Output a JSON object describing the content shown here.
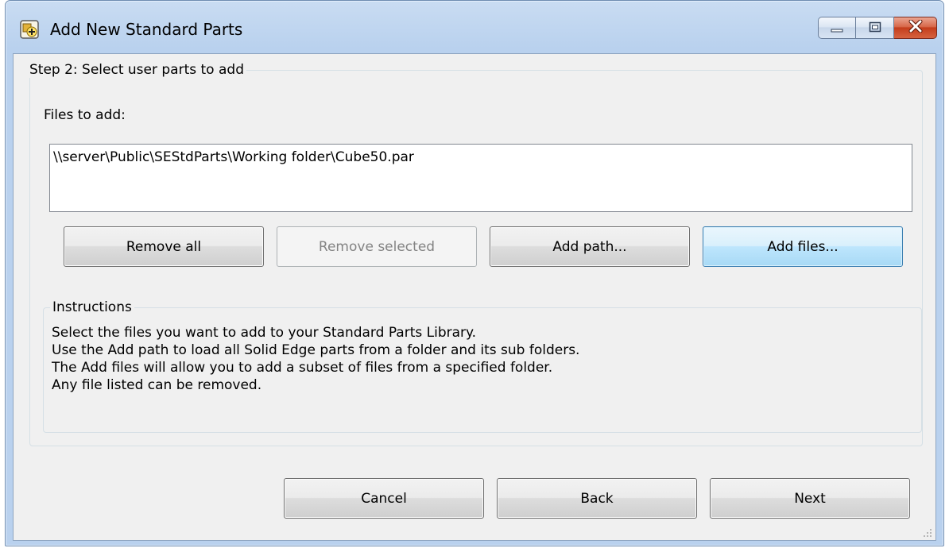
{
  "window": {
    "title": "Add New Standard Parts",
    "icon": "add-part-icon"
  },
  "caption_buttons": {
    "minimize_icon": "minimize-icon",
    "maximize_icon": "maximize-icon",
    "close_icon": "close-icon"
  },
  "step_group": {
    "legend": "Step 2: Select user parts to add",
    "files_label": "Files to add:",
    "files": [
      "\\\\server\\Public\\SEStdParts\\Working folder\\Cube50.par"
    ],
    "buttons": {
      "remove_all": "Remove all",
      "remove_selected": "Remove selected",
      "add_path": "Add path...",
      "add_files": "Add files..."
    }
  },
  "instructions": {
    "legend": "Instructions",
    "lines": [
      "Select the files you want to add to your Standard Parts Library.",
      "Use the Add path to load all Solid Edge parts from a folder and its sub folders.",
      "The Add files will allow you to add a subset of files from a specified folder.",
      "Any file listed can be removed."
    ]
  },
  "footer": {
    "cancel": "Cancel",
    "back": "Back",
    "next": "Next"
  }
}
